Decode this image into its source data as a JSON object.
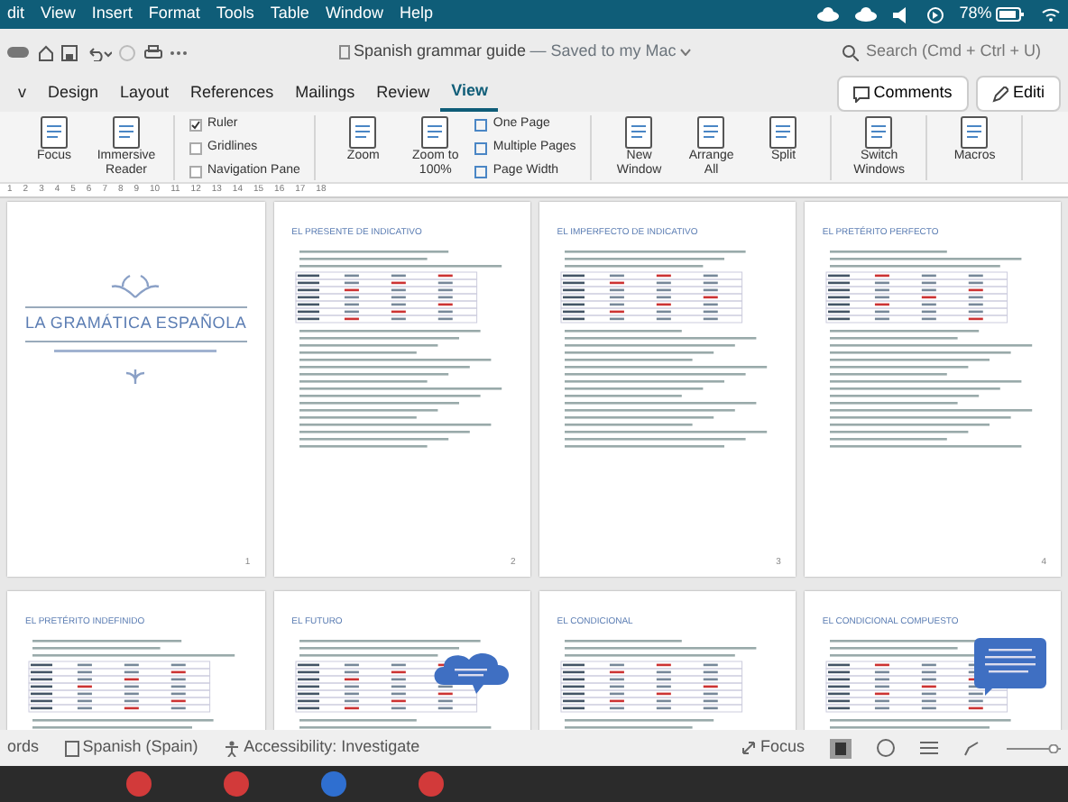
{
  "menu_bar": {
    "items": [
      "dit",
      "View",
      "Insert",
      "Format",
      "Tools",
      "Table",
      "Window",
      "Help"
    ],
    "battery": "78%"
  },
  "title_bar": {
    "document": "Spanish grammar guide",
    "status": "— Saved to my Mac",
    "search": {
      "placeholder": "Search (Cmd + Ctrl + U)"
    }
  },
  "tabs": [
    {
      "label": "v",
      "selected": false
    },
    {
      "label": "Design",
      "selected": false
    },
    {
      "label": "Layout",
      "selected": false
    },
    {
      "label": "References",
      "selected": false
    },
    {
      "label": "Mailings",
      "selected": false
    },
    {
      "label": "Review",
      "selected": false
    },
    {
      "label": "View",
      "selected": true
    }
  ],
  "buttons": [
    "Comments",
    "Editi"
  ],
  "ribbon": {
    "groups": [
      [
        {
          "kind": "large",
          "label": "Focus"
        },
        {
          "kind": "large",
          "label": "Immersive Reader"
        }
      ],
      [
        {
          "kind": "check",
          "label": "Ruler",
          "checked": true
        },
        {
          "kind": "check",
          "label": "Gridlines",
          "checked": false
        },
        {
          "kind": "check",
          "label": "Navigation Pane",
          "checked": false
        }
      ],
      [
        {
          "kind": "large",
          "label": "Zoom"
        },
        {
          "kind": "large",
          "label": "Zoom to 100%"
        },
        {
          "kind": "small",
          "label": "One Page"
        },
        {
          "kind": "small",
          "label": "Multiple Pages"
        },
        {
          "kind": "small",
          "label": "Page Width"
        }
      ],
      [
        {
          "kind": "large",
          "label": "New Window"
        },
        {
          "kind": "large",
          "label": "Arrange All"
        },
        {
          "kind": "large",
          "label": "Split"
        }
      ],
      [
        {
          "kind": "large",
          "label": "Switch Windows"
        }
      ],
      [
        {
          "kind": "large",
          "label": "Macros"
        }
      ]
    ]
  },
  "ruler": [
    "1",
    "2",
    "3",
    "4",
    "5",
    "6",
    "7",
    "8",
    "9",
    "10",
    "11",
    "12",
    "13",
    "14",
    "15",
    "16",
    "17",
    "18"
  ],
  "pages": [
    {
      "kind": "cover",
      "heading": "LA GRAMÁTICA ESPAÑOLA",
      "number": "1"
    },
    {
      "kind": "content",
      "heading": "EL PRESENTE DE INDICATIVO",
      "number": "2"
    },
    {
      "kind": "content",
      "heading": "EL IMPERFECTO DE INDICATIVO",
      "number": "3"
    },
    {
      "kind": "content",
      "heading": "EL PRETÉRITO PERFECTO",
      "number": "4"
    },
    {
      "kind": "content",
      "heading": "EL PRETÉRITO INDEFINIDO"
    },
    {
      "kind": "content",
      "heading": "EL FUTURO",
      "overlay": {
        "kind": "cloud"
      }
    },
    {
      "kind": "content",
      "heading": "EL CONDICIONAL"
    },
    {
      "kind": "content",
      "heading": "EL CONDICIONAL COMPUESTO",
      "overlay": {
        "kind": "callout"
      }
    }
  ],
  "status_bar": {
    "items": [
      "ords",
      "Spanish (Spain)",
      "Accessibility: Investigate"
    ],
    "focus": "Focus"
  }
}
